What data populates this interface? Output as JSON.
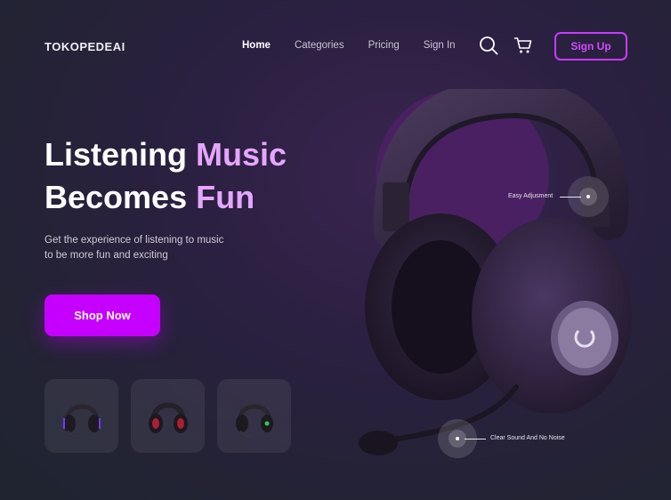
{
  "brand": {
    "name": "TOKOPEDEAI"
  },
  "nav": {
    "items": [
      {
        "label": "Home",
        "active": true
      },
      {
        "label": "Categories",
        "active": false
      },
      {
        "label": "Pricing",
        "active": false
      },
      {
        "label": "Sign In",
        "active": false
      }
    ],
    "search_icon": "search-icon",
    "cart_icon": "cart-icon",
    "signup_label": "Sign Up"
  },
  "hero": {
    "title_line1_plain": "Listening ",
    "title_line1_accent": "Music",
    "title_line2_plain": "Becomes ",
    "title_line2_accent": "Fun",
    "subtitle_line1": "Get the experience of listening to music",
    "subtitle_line2": "to be more fun and exciting",
    "cta_label": "Shop Now"
  },
  "product": {
    "callout_top": "Easy Adjusment",
    "callout_bottom": "Clear Sound And No Noise"
  },
  "thumbnails": [
    {
      "icon": "headphone-icon",
      "accent": "#6b3cff"
    },
    {
      "icon": "headphone-icon",
      "accent": "#d0203a"
    },
    {
      "icon": "headphone-icon",
      "accent": "#3ac060"
    }
  ],
  "colors": {
    "accent": "#c600ff",
    "accent_text": "#e6a6ff",
    "signup_border": "#c93bff"
  }
}
